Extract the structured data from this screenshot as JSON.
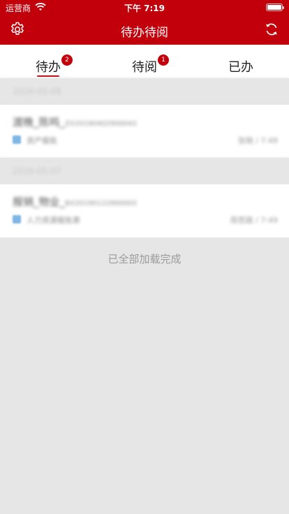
{
  "status_bar": {
    "carrier": "运营商",
    "time": "下午 7:19"
  },
  "header": {
    "title": "待办待阅",
    "left_icon": "gear-icon",
    "right_icon": "refresh-icon",
    "accent_color": "#c1000b"
  },
  "tabs": [
    {
      "label": "待办",
      "badge": "2",
      "active": true
    },
    {
      "label": "待阅",
      "badge": "1",
      "active": false
    },
    {
      "label": "已办",
      "badge": "",
      "active": false
    }
  ],
  "groups": [
    {
      "date": "2026-05-08",
      "items": [
        {
          "title": "渡晚_陈鸣_",
          "code": "ZX20190402900043",
          "type": "资产报批",
          "meta": "张晓 / 7:49"
        }
      ]
    },
    {
      "date": "2026-05-07",
      "items": [
        {
          "title": "报销_物业_",
          "code": "BX20190122900003",
          "type": "人力资源报批表",
          "meta": "周思路 / 7:49"
        }
      ]
    }
  ],
  "footer": "已全部加载完成"
}
